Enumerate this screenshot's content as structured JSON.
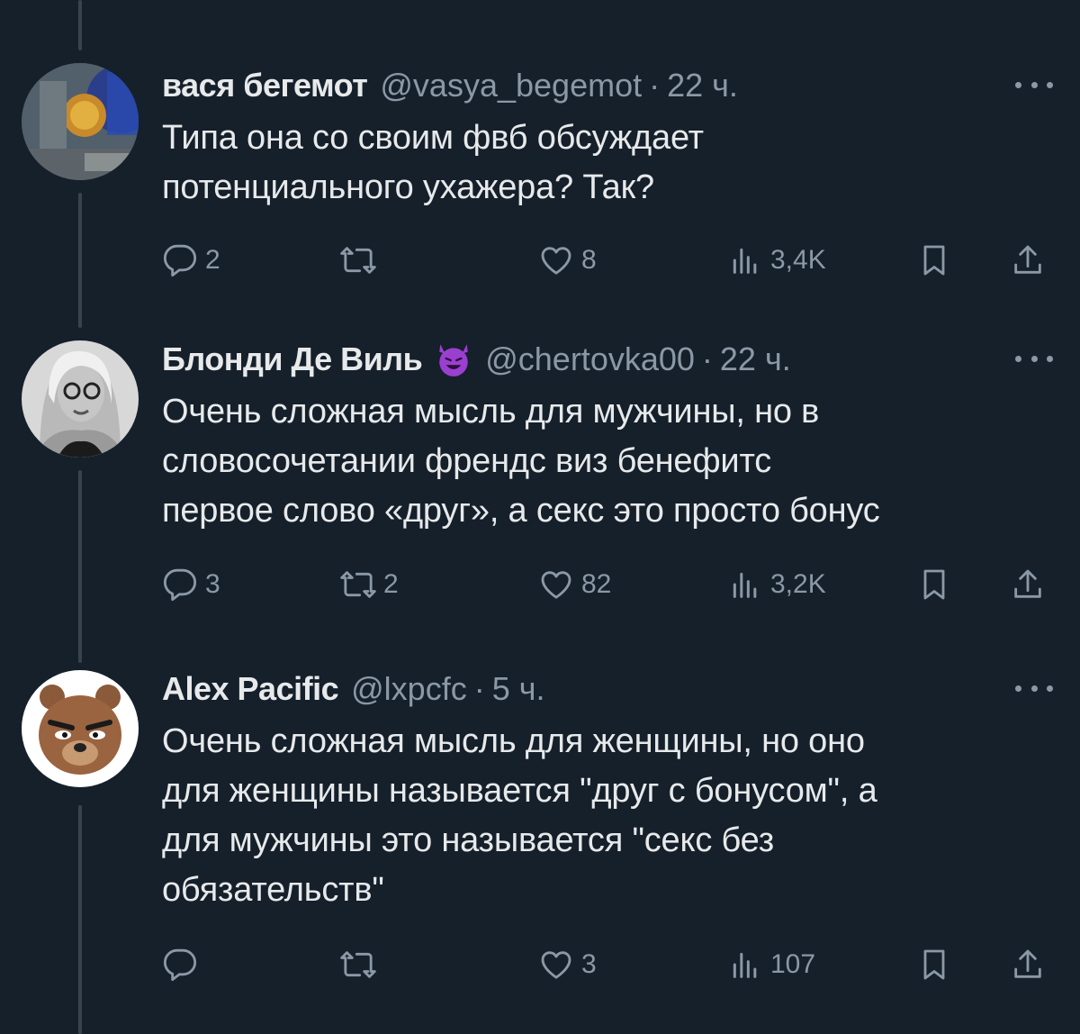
{
  "tweets": [
    {
      "name": "вася бегемот",
      "handle": "@vasya_begemot",
      "separator": "·",
      "time": "22 ч.",
      "text": "Типа она со своим фвб обсуждает\nпотенциального ухажера? Так?",
      "stats": {
        "replies": "2",
        "retweets": "",
        "likes": "8",
        "views": "3,4K"
      }
    },
    {
      "name": "Блонди Де Виль",
      "emoji": "smiling-devil-emoji",
      "handle": "@chertovka00",
      "separator": "·",
      "time": "22 ч.",
      "text": "Очень сложная мысль для мужчины, но в\nсловосочетании френдс виз бенефитс\nпервое слово «друг», а секс это просто бонус",
      "stats": {
        "replies": "3",
        "retweets": "2",
        "likes": "82",
        "views": "3,2K"
      }
    },
    {
      "name": "Alex Pacific",
      "handle": "@lxpcfc",
      "separator": "·",
      "time": "5 ч.",
      "text": "Очень сложная мысль для женщины, но оно\nдля женщины называется \"друг с бонусом\", а\nдля мужчины это называется \"секс без\nобязательств\"",
      "stats": {
        "replies": "",
        "retweets": "",
        "likes": "3",
        "views": "107"
      }
    }
  ],
  "icons": [
    "reply-icon",
    "retweet-icon",
    "like-icon",
    "views-icon",
    "bookmark-icon",
    "share-icon",
    "more-icon"
  ],
  "colors": {
    "background": "#15202b",
    "text": "#e7e9ea",
    "secondary": "#8b98a5",
    "thread_line": "#38444d"
  }
}
